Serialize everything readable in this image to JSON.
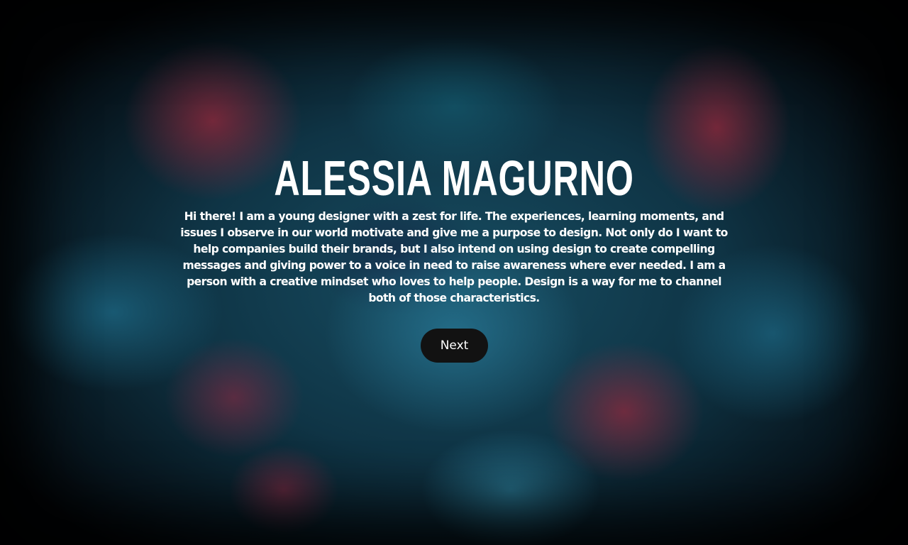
{
  "hero": {
    "name": "ALESSIA MAGURNO",
    "bio": "Hi there! I am a young designer with a zest for life. The experiences, learning moments, and issues I observe in our world motivate and give me a purpose to design. Not only do I want to help companies build their brands, but I also intend on using design to create compelling messages and giving power to a voice in need to raise awareness where ever needed. I am a person with a creative mindset who loves to help people. Design is a way for me to channel both of those characteristics.",
    "next_label": "Next"
  },
  "colors": {
    "text": "#ffffff",
    "button_bg": "#121212",
    "background_teal": "#174d62",
    "background_red": "#96283c"
  }
}
